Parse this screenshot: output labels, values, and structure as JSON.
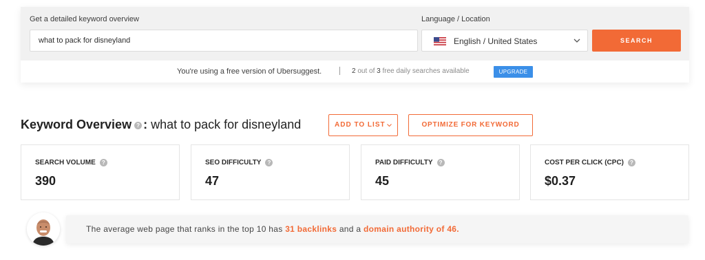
{
  "search": {
    "keyword_label": "Get a detailed keyword overview",
    "keyword_value": "what to pack for disneyland",
    "language_label": "Language / Location",
    "language_value": "English / United States",
    "search_button": "SEARCH"
  },
  "notice": {
    "free_text": "You're using a free version of Ubersuggest.",
    "used": "2",
    "out_of_text": "out of",
    "total": "3",
    "available_text": "free daily searches available",
    "upgrade_button": "UPGRADE"
  },
  "overview": {
    "title_bold": "Keyword Overview",
    "colon": ":",
    "keyword": "what to pack for disneyland",
    "add_to_list": "ADD TO LIST",
    "optimize": "OPTIMIZE FOR KEYWORD"
  },
  "stats": [
    {
      "label": "SEARCH VOLUME",
      "value": "390"
    },
    {
      "label": "SEO DIFFICULTY",
      "value": "47"
    },
    {
      "label": "PAID DIFFICULTY",
      "value": "45"
    },
    {
      "label": "COST PER CLICK (CPC)",
      "value": "$0.37"
    }
  ],
  "tip": {
    "text_1": "The average web page that ranks in the top 10 has",
    "backlinks": "31 backlinks",
    "text_2": "and a",
    "domain_authority": "domain authority of 46."
  },
  "colors": {
    "accent": "#f26a36",
    "upgrade": "#3b8fe8"
  },
  "icons": {
    "help": "question-mark-icon",
    "flag": "us-flag-icon",
    "dropdown": "chevron-down-icon",
    "avatar": "user-avatar"
  }
}
